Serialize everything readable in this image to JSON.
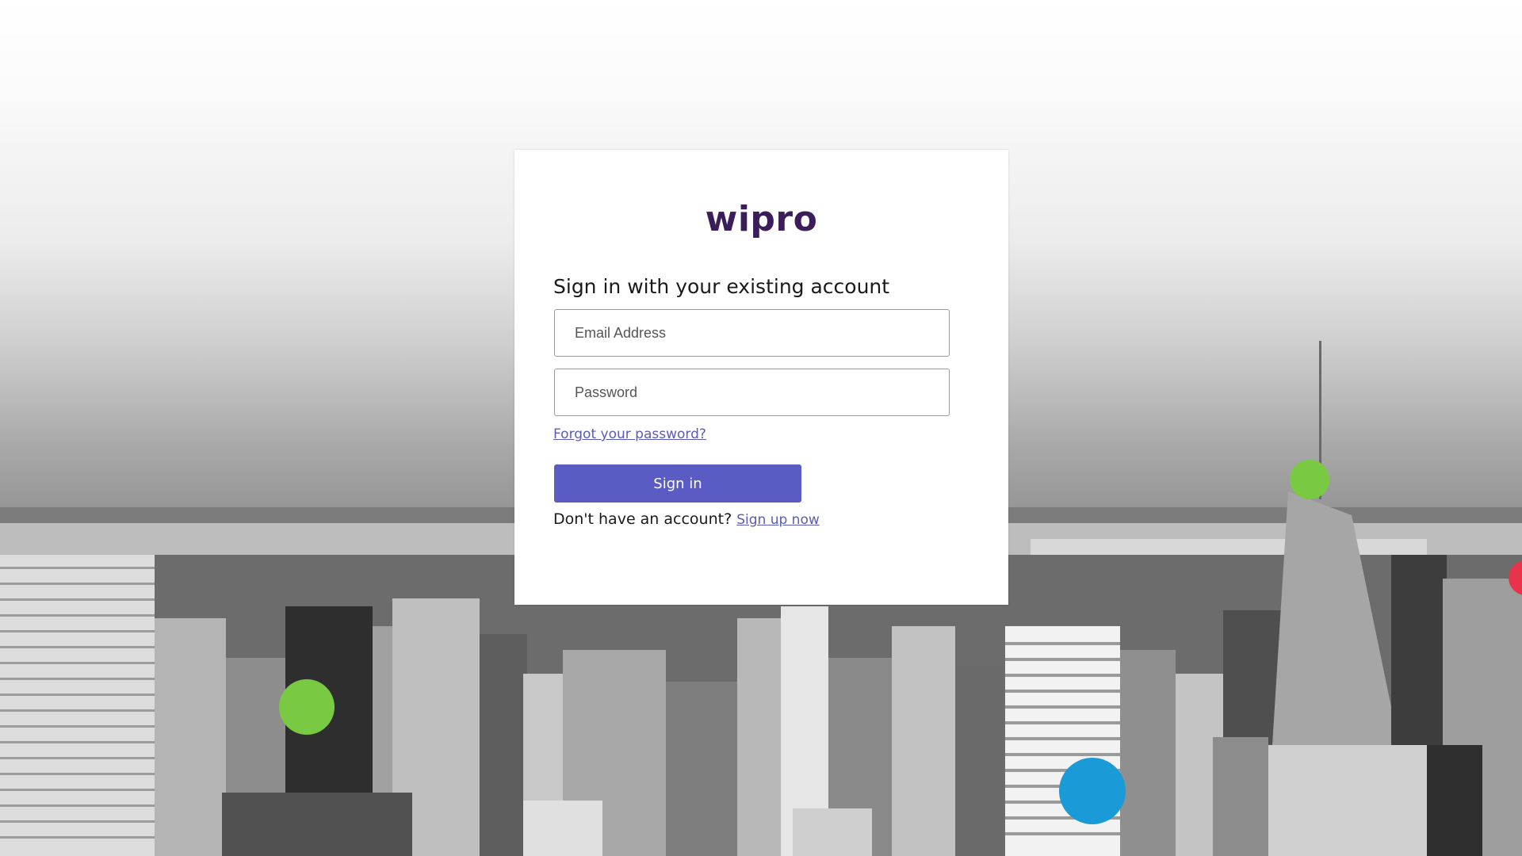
{
  "brand": {
    "logo_text": "wipro",
    "logo_color": "#3b1d5a"
  },
  "signin_form": {
    "heading": "Sign in with your existing account",
    "email_placeholder": "Email Address",
    "password_placeholder": "Password",
    "forgot_password_link": "Forgot your password?",
    "signin_button": "Sign in",
    "signup_prompt": "Don't have an account?",
    "signup_link": "Sign up now"
  },
  "colors": {
    "accent": "#5b5bc4",
    "link": "#5a5bb8",
    "dot_green": "#7ac943",
    "dot_blue": "#1a9ad6",
    "dot_red": "#e8334a"
  }
}
